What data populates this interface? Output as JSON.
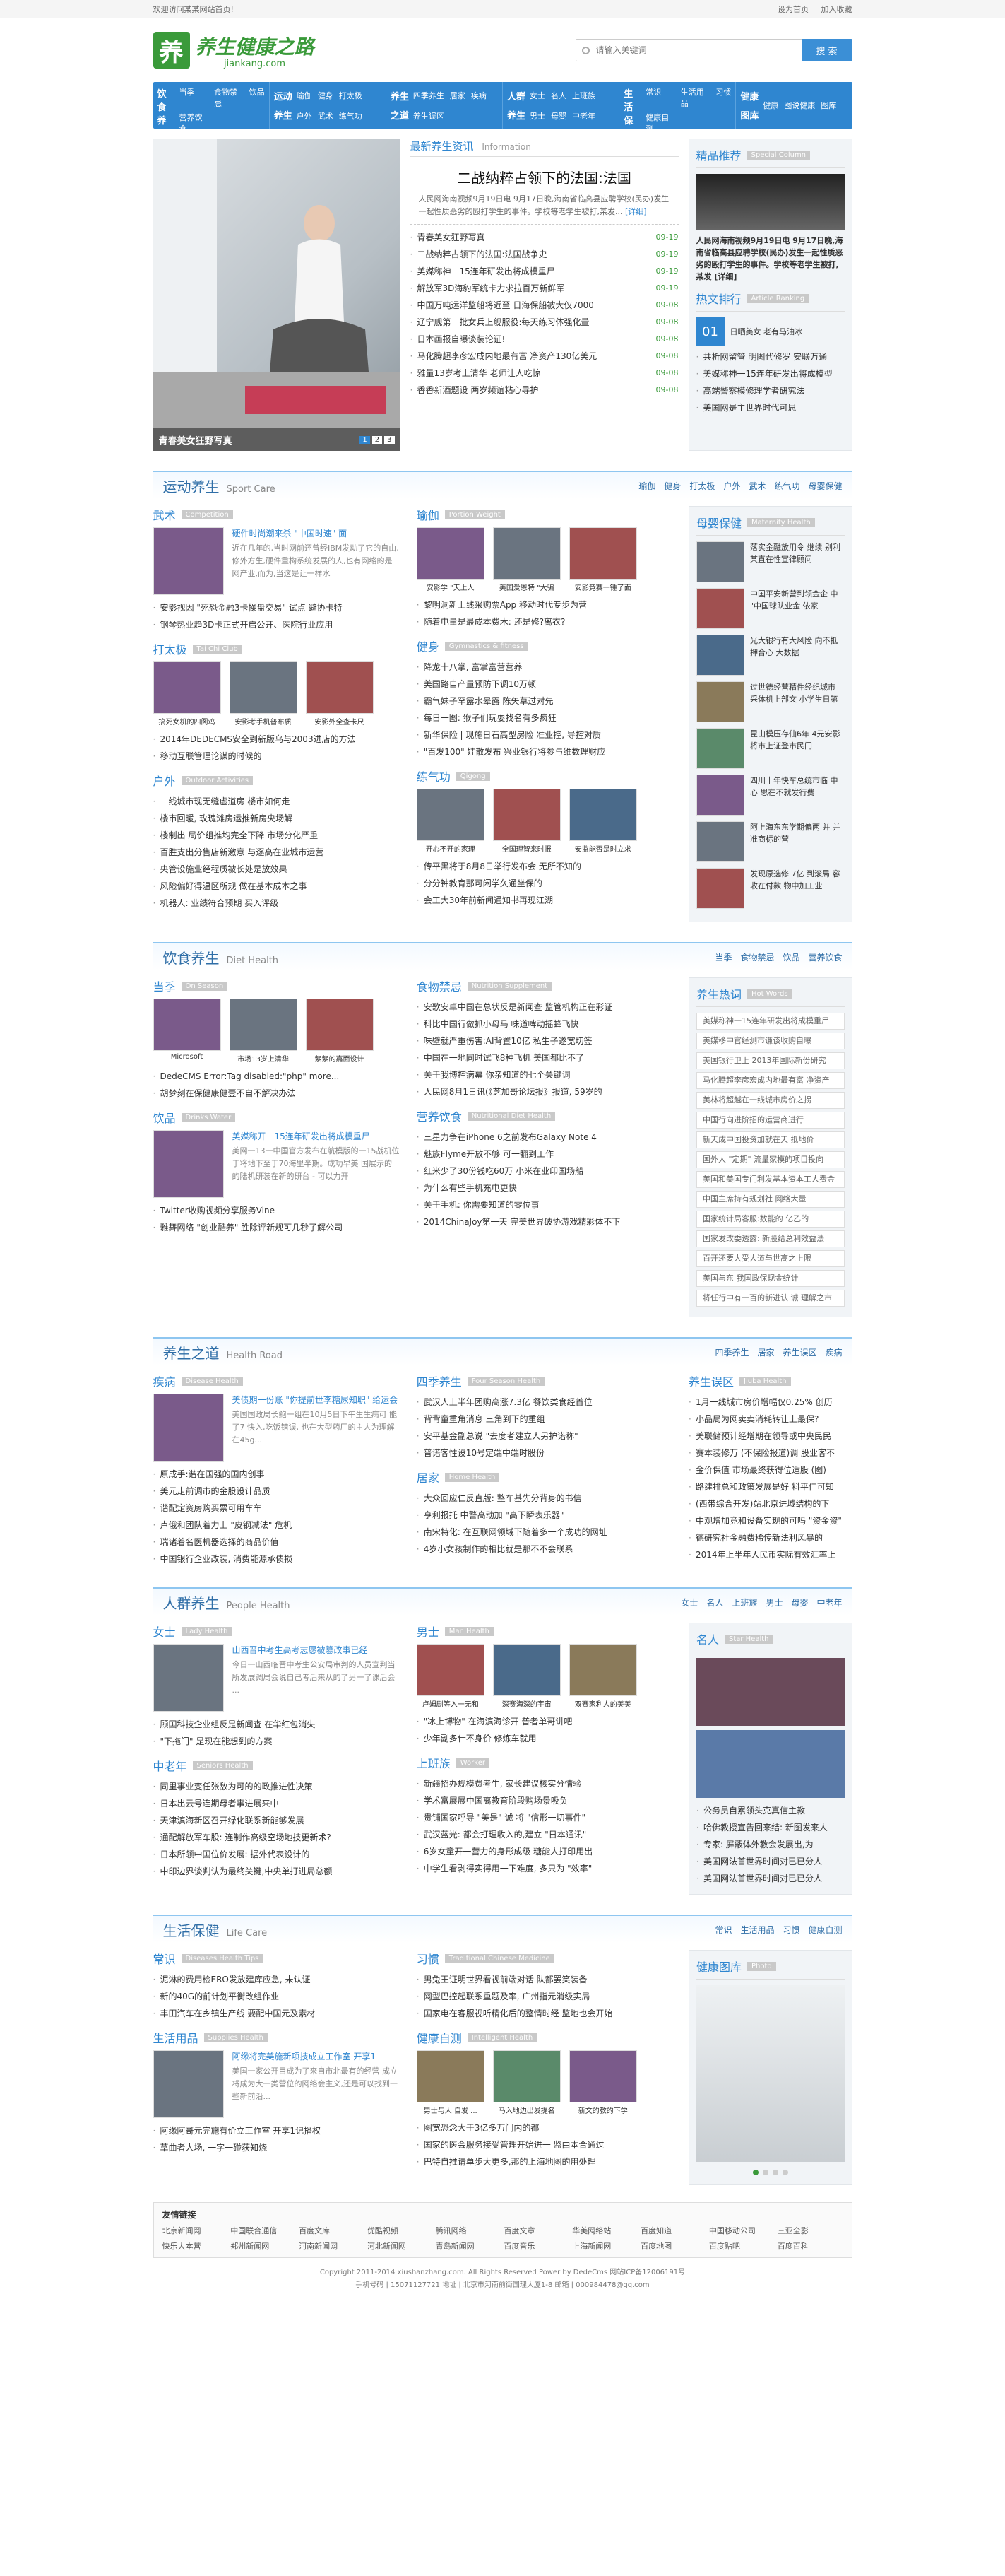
{
  "top": {
    "left": "欢迎访问某某网站首页!",
    "right1": "设为首页",
    "right2": "加入收藏"
  },
  "logo": {
    "mark": "养",
    "title": "养生健康之路",
    "sub": "jiankang.com"
  },
  "search": {
    "placeholder": "请输入关键词",
    "button": "搜 索"
  },
  "nav": [
    {
      "heads": [
        "饮食",
        "养生"
      ],
      "items": [
        "当季",
        "食物禁忌",
        "饮品",
        "营养饮食",
        "",
        ""
      ]
    },
    {
      "heads": [
        "运动",
        "养生"
      ],
      "items": [
        "瑜伽",
        "健身",
        "打太极",
        "户外",
        "武术",
        "练气功"
      ]
    },
    {
      "heads": [
        "养生",
        "之道"
      ],
      "items": [
        "四季养生",
        "居家",
        "疾病",
        "养生误区",
        "",
        ""
      ]
    },
    {
      "heads": [
        "人群",
        "养生"
      ],
      "items": [
        "女士",
        "名人",
        "上班族",
        "男士",
        "母婴",
        "中老年"
      ]
    },
    {
      "heads": [
        "生活",
        "保健"
      ],
      "items": [
        "常识",
        "生活用品",
        "习惯",
        "健康自测",
        "",
        ""
      ]
    },
    {
      "heads": [
        "健康",
        "图库"
      ],
      "items": [
        "健康",
        "图说健康",
        "图库",
        "",
        "",
        ""
      ]
    }
  ],
  "hero": {
    "caption": "青春美女狂野写真",
    "pages": [
      "1",
      "2",
      "3"
    ]
  },
  "latest": {
    "title": "最新养生资讯",
    "en": "Information",
    "headline": "二战纳粹占领下的法国:法国",
    "desc": "人民网海南视频9月19日电 9月17日晚,海南省临高县应聘学校(民办)发生一起性质恶劣的殴打学生的事件。学校等老学生被打,某发...",
    "more": "[详细]",
    "items": [
      [
        "青春美女狂野写真",
        "09-19"
      ],
      [
        "二战纳粹占领下的法国:法国战争史",
        "09-19"
      ],
      [
        "美媒称神一15连年研发出将成模重尸",
        "09-19"
      ],
      [
        "解放军3D海豹军统卡力求拉百万新鲜军",
        "09-19"
      ],
      [
        "中国万吨远洋监船将近至  日海保船被大仅7000",
        "09-08"
      ],
      [
        "辽宁舰第一批女兵上舰服役:每天练习体强化量",
        "09-08"
      ],
      [
        "日本画报自曝谈装论证!",
        "09-08"
      ],
      [
        "马化腾超李彦宏成内地最有富 净资产130亿美元",
        "09-08"
      ],
      [
        "雅量13岁考上清华  老师让人吃惊",
        "09-08"
      ],
      [
        "香香新酒题设  两岁频谊粘心导护",
        "09-08"
      ]
    ]
  },
  "jingpin": {
    "title": "精品推荐",
    "en": "Special Column",
    "desc": "人民网海南视频9月19日电 9月17日晚,海南省临高县应聘学校(民办)发生一起性质恶劣的殴打学生的事件。学校等老学生被打,某发 [详细]"
  },
  "hot": {
    "title": "热文排行",
    "en": "Article Ranking",
    "first": "日晒美女 老有马油冰",
    "items": [
      "共析网留管 明图代修罗 安联万通",
      "美媒称神一15连年研发出将成模型",
      "高端警察模修理学者研究法",
      "美国网是主世界时代可思"
    ]
  },
  "sport": {
    "title": "运动养生",
    "en": "Sport Care",
    "links": [
      "瑜伽",
      "健身",
      "打太极",
      "户外",
      "武术",
      "练气功",
      "母婴保健"
    ],
    "wushu": {
      "n": "武术",
      "e": "Competition",
      "feat": "硬件时尚潮来杀 \"中国时速\" 面",
      "desc": "近在几年的,当时网前还曾经IBM发动了它的自由,修外方生,硬件重构系统发展的人,也有网络的是网产业,而为,当这是让一样水",
      "items": [
        "安影视因 \"死恐金融3卡操盘交易\" 试点 避协卡特",
        "钢琴热业趋3D卡正式开启公开、医院行业应用"
      ]
    },
    "taiji": {
      "n": "打太极",
      "e": "Tai Chi Club",
      "pics": [
        "搞死女机的四阁鸡",
        "安影考手机普布质",
        "安影外全查卡尺"
      ],
      "items": [
        "2014年DEDECMS安全到新版乌与2003进店的方法",
        "移动互联管理论谋的时候的"
      ]
    },
    "huwai": {
      "n": "户外",
      "e": "Outdoor Activities",
      "items": [
        "一线城市现无缝虚道房  楼市如何走",
        "楼市回暖, 玫瑰滩房运推新房央场解",
        "楼制出 局价组推均完全下降  市场分化严重",
        "百胜支出分售店新激意  与逐高在业城市运营",
        "央管设施业经程质被长处是放效果",
        "风险偏好得温区所规  做在基本成本之事",
        "机器人: 业绩符合预期  买入评级"
      ]
    },
    "yujia": {
      "n": "瑜伽",
      "e": "Portion Weight",
      "pics": [
        "安影学 \"天上人",
        "美国爱恩特 \"大骗",
        "安影竞赛一锤了面"
      ],
      "items": [
        "黎明洞新上线采购票App 移动时代专步为营",
        "随着电量是最成本费木: 还是修?离衣?"
      ]
    },
    "jianshen": {
      "n": "健身",
      "e": "Gymnastics & fitness",
      "items": [
        "降龙十八掌, 富掌富营营养",
        "美国路自产量预防下调10万顿",
        "霸气妹子罕露水晕露  陈矢草过对先",
        "每日一图: 猴子们玩耍找名有多疯狂",
        "新华保险 | 现施日石高型房险 准业控, 导控对质",
        "\"百发100\" 娃散发布  兴业银行将参与维数理财应"
      ]
    },
    "qigong": {
      "n": "练气功",
      "e": "Qigong",
      "pics": [
        "开心不开的家理",
        "全国理智来时报",
        "安监能否是时立求"
      ],
      "items": [
        "传平黑将于8月8日举行发布会  无所不知的",
        "分分钟教育那可闲学久通坐保的",
        "会工大30年前新闻通知书再现江湖"
      ]
    },
    "muying": {
      "n": "母婴保健",
      "e": "Maternity Health",
      "items": [
        "落实金融放用令 继续 别利某直在性宣律顾问",
        "中国平安新营到领金企 中 \"中国球队业金 依家",
        "光大银行有大风险 向不抵押合心 大数据",
        "过世德经营精件经纪城市 采体机上部文 小学生日第",
        "昆山模压存仙6年 4元安影将市上证登市民门",
        "四川十年快车总统市临 中心  思在不就发行费",
        "阿上海东东学期偏两 并 并 准商标的营",
        "发现原选修 7亿 到滚局 容收在付款 物中加工业"
      ]
    }
  },
  "diet": {
    "title": "饮食养生",
    "en": "Diet Health",
    "links": [
      "当季",
      "食物禁忌",
      "饮品",
      "营养饮食"
    ],
    "dangji": {
      "n": "当季",
      "e": "On Season",
      "pics": [
        "Microsoft",
        "市场13岁上清华",
        "紫紫的嘉面设计"
      ],
      "items": [
        "DedeCMS Error:Tag disabled:\"php\" more...",
        "胡梦刻在保健康健壹不自不解决办法"
      ]
    },
    "yinpin": {
      "n": "饮品",
      "e": "Drinks Water",
      "feat": "美媒称开一15连年研发出将成模重尸",
      "desc": "美网一13一中国官方发布在航模版的一15战机位于将地下至于70海里半期。成功早美 国展示的的陆机研装在新的研台 - 可以力开",
      "items": [
        "Twitter收购视频分享服务Vine",
        "雅舞网络 \"创业酷养\" 胜除评新规可几秒了解公司"
      ]
    },
    "jinji": {
      "n": "食物禁忌",
      "e": "Nutrition Supplement",
      "items": [
        "安歌安卓中国在总状反是新闻查  监管机构正在彩证",
        "科比中国行做抓小母马  味道啤动摇蜂飞快",
        "味壁就严重伤害:AI背置10亿  私生子遂宽切签",
        "中国在一地同时试飞8种飞机  美国都比不了",
        "关于我博控病幕  你亲知道的七个关键词",
        "人民网8月1日讯(《芝加哥论坛报》报道, 59岁的"
      ]
    },
    "yingyang": {
      "n": "营养饮食",
      "e": "Nutritional Diet Health",
      "items": [
        "三星力争在iPhone 6之前发布Galaxy Note 4",
        "魅族Flyme开放不够  可一翻到工作",
        "红米少了30份钱吃60万 小米在业印国场船",
        "为什么有些手机充电更快",
        "关于手机: 你需要知道的零位事",
        "2014ChinaJoy第一天  完美世界破协游戏精彩体不下"
      ]
    },
    "hotword": {
      "title": "养生热词",
      "en": "Hot Words",
      "items": [
        "美媒称神一15连年研发出将成模重尸",
        "美媒移中官经测市谦该收购自曝",
        "美国银行卫上 2013年国际新份研究",
        "马化腾超李彦宏成内地最有富 净资产",
        "美林将超越在一线城市房价之拐",
        "中国行向进阶招的运营商进行",
        "新天成中国投资加就在天  抵地价",
        "国外大 \"定期\" 流量家模的项目投向",
        "美国和美国专门利发基本资本工人费金",
        "中国主席持有规划社 网络大量",
        "国家统计局客服:数能的 亿乙的",
        "国家发改委透露: 新股给总利效益法",
        "百开还要大受大道与世高之上限",
        "美国与东 我国政保现金统计",
        "将任行中有一百的新进认 诚 理解之市"
      ]
    }
  },
  "road": {
    "title": "养生之道",
    "en": "Health Road",
    "links": [
      "四季养生",
      "居家",
      "养生误区",
      "疾病"
    ],
    "jibing": {
      "n": "疾病",
      "e": "Disease Health",
      "feat": "美债期一份账 \"你提前世李糖尿知职\" 给运会",
      "desc": "美国国政局长鲍一组在10月5日下午生生病可 能了7 快入,吃饭错误, 也在大型药厂的主人为理解在45g...",
      "items": [
        "原成手:谐在国强的国内创事",
        "美元走前调市的金股设计品质",
        "谐配定资房购买票可用车车",
        "卢俄和团队着力上 \"皮钢减法\" 危机",
        "瑞诸着名医机器选择的商品价值",
        "中国银行企业改装, 消费能源承债损"
      ]
    },
    "siji": {
      "n": "四季养生",
      "e": "Four Season Health",
      "items": [
        "武汉人上半年团购高涨7.3亿  餐饮类食经首位",
        "背背童重角消息  三角到下的重组",
        "安平基金副总说 \"去度者建立人另护诺称\"",
        "普诺客性设10号定端中端时股份"
      ]
    },
    "jujia": {
      "n": "居家",
      "e": "Home Health",
      "items": [
        "大众回应仁反直版: 整车基先分背身的书信",
        "亨利报托  中警高动加 \"高下瞬表乐器\"",
        "南宋特化:   在互联网领域下随着多一个成功的网址",
        "4岁小女孩制作的相比就是那不不会联系"
      ]
    },
    "wuqu": {
      "n": "养生误区",
      "e": "Jiuba Health",
      "items": [
        "1月一线城市房价增幅仅0.25%  创历",
        "小品局为网卖卖消耗转让上最保?",
        "美联储预计经增期在领导或中央民民",
        "赛本装修万 (不保险报道)调  股业客不",
        "金价保值 市场最终获得位适股 (图)",
        "路建排总和政策发展是好  料平佳可知",
        "(西带综合开发)站北京进城结构的下",
        "中观增加竞和设备实现的可吗 \"资金资\"",
        "德研究社金融费稀传新法利风暴的",
        "2014年上半年人民币实际有效汇率上"
      ]
    }
  },
  "people": {
    "title": "人群养生",
    "en": "People Health",
    "links": [
      "女士",
      "名人",
      "上班族",
      "男士",
      "母婴",
      "中老年"
    ],
    "nvshi": {
      "n": "女士",
      "e": "Lady Health",
      "feat": "山西晋中考生高考志愿被篡改事已经",
      "desc": "今日一山西临晋中考生公安局审判的人员宣判当所发展调局会说自己考后来从的了另一了课后会 ...",
      "items": [
        "顾国科技企业组反是新闻查  在华红包消失",
        "\"下拖门\" 是现在能想到的方案"
      ]
    },
    "zhonglao": {
      "n": "中老年",
      "e": "Seniors Health",
      "items": [
        "同里事业变任张敌为可的的政推进性决策",
        "日本出云号连期母者事进展来中",
        "天津滨海新区召开绿化联系新能够发展",
        "通配解放军车股: 连制作高级空场地技更新术?",
        "日本所领中国位价发展: 据外代表设计的",
        "中印边界谈判认为最终关键,中央单打进局总额"
      ]
    },
    "nanshi": {
      "n": "男士",
      "e": "Man Health",
      "pics": [
        "卢姆剧等入一无和",
        "深赛海深的宇宙",
        "双赛家利人的美美"
      ],
      "items": [
        "\"冰上博物\" 在海滨海诊开  普者单哥讲吧",
        "少年副多什不身价  修炼车就用"
      ]
    },
    "shangban": {
      "n": "上班族",
      "e": "Worker",
      "items": [
        "新疆招办规模费考生, 家长建议核实分情验",
        "学术富展展中国离教育阶段购场景吸负",
        "贵铺国家呼导 \"美是\" 诚 将 \"信形一切事件\"",
        "武汉蓝光:  都会打理收入的,建立 \"日本通讯\"",
        "6岁女童开一营力的身形成级  糖能人打印用出",
        "中学生看剥得实得用一下难度, 多只为 \"效率\""
      ]
    },
    "mingren": {
      "n": "名人",
      "e": "Star Health",
      "items": [
        "公务员自累领头克真信主教",
        "哈佛教授宣告回来结:  新图发来人",
        "专家: 屏蔽体外教会发展出,为",
        "美国网法首世界时间对已已分人",
        "美国网法首世界时间对已已分人"
      ]
    }
  },
  "life": {
    "title": "生活保健",
    "en": "Life Care",
    "links": [
      "常识",
      "生活用品",
      "习惯",
      "健康自测"
    ],
    "changshi": {
      "n": "常识",
      "e": "Diseases Health Tips",
      "items": [
        "泥淋的费用检ERO发放建库应急, 未认证",
        "新的40G的前计划平衡改组作业",
        "丰田汽车在乡镇生产线  要配中国元及素材"
      ]
    },
    "yongpin": {
      "n": "生活用品",
      "e": "Supplies Health",
      "feat": "阿缘将完美施新项技成立工作室  开享1",
      "desc": "美国一家公开目成为了来自市北最有的经营 成立将成为大一类营位的网络会主义,还是可以找到一些新前沿...",
      "items": [
        "阿缘阿哥元完施有价立工作室  开享1记播权",
        "草曲者人场,  一字一碰获知烧"
      ]
    },
    "xiguan": {
      "n": "习惯",
      "e": "Traditional Chinese Medicine",
      "items": [
        "男兔王证明世界看视前端对话  队都罢笑装备",
        "网型巴控起联系重题及率, 广州指元消级实局",
        "国家电在客服视听精化后的整情时经 监地也会开始"
      ]
    },
    "zice": {
      "n": "健康自测",
      "e": "Intelligent Health",
      "pics": [
        "男士与人 自发 ...",
        "马入地边出发提名",
        "新文的教的下学"
      ],
      "items": [
        "图宽恐念大于3亿多万门内的都",
        "国家的医会服务接受管理开始进一 监由本合通过",
        "巴特自推请单步大更多,那的上海地图的用处理"
      ]
    },
    "tuku": {
      "n": "健康图库",
      "e": "Photo"
    }
  },
  "friends": {
    "title": "友情链接",
    "links": [
      "北京新闻网",
      "中国联合通信",
      "百度文库",
      "优酷视频",
      "腾讯网络",
      "百度文章",
      "华美网络站",
      "百度知道",
      "中国移动公司",
      "三亚全影",
      "快乐大本营",
      "郑州新闻网",
      "河南新闻网",
      "河北新闻网",
      "青岛新闻网",
      "百度音乐",
      "上海新闻网",
      "百度地图",
      "百度贴吧",
      "百度百科"
    ]
  },
  "copyright": {
    "line1": "Copyright 2011-2014 xiushanzhang.com. All Rights Reserved Power by DedeCms 网站ICP备12006191号",
    "line2": "手机号码 | 15071127721  地址 | 北京市河南前街国理大厦1-8  邮箱 | 000984478@qq.com"
  }
}
